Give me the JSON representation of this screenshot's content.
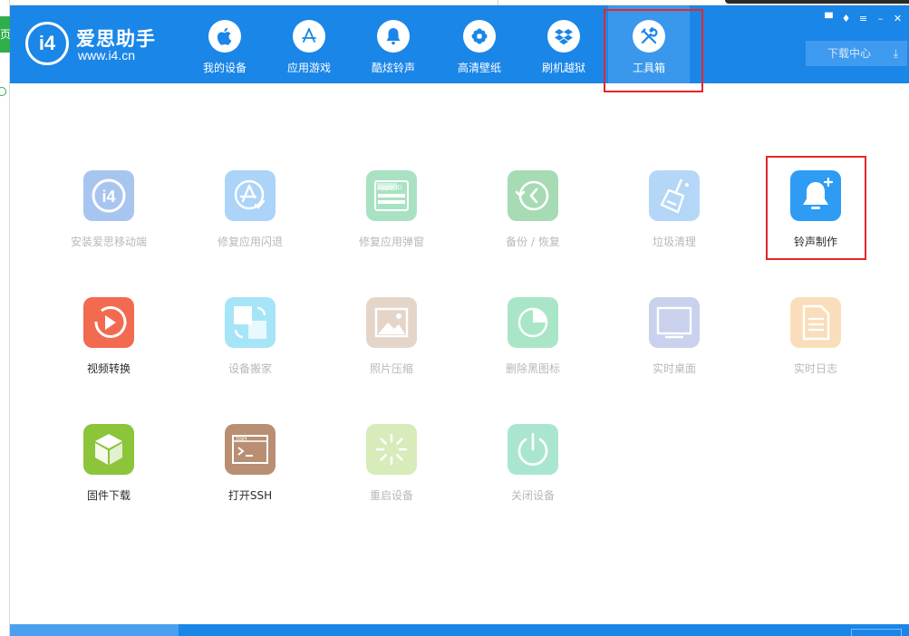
{
  "background": {
    "left_tab_char": "页"
  },
  "header": {
    "logo_mark": "i4",
    "brand_name": "爱思助手",
    "brand_url": "www.i4.cn",
    "nav": [
      {
        "label": "我的设备",
        "icon": "apple-icon"
      },
      {
        "label": "应用游戏",
        "icon": "app-store-icon"
      },
      {
        "label": "酷炫铃声",
        "icon": "bell-icon"
      },
      {
        "label": "高清壁纸",
        "icon": "flower-icon"
      },
      {
        "label": "刷机越狱",
        "icon": "dropbox-icon"
      },
      {
        "label": "工具箱",
        "icon": "tools-icon",
        "active": true
      }
    ],
    "window_controls": [
      "feedback-icon",
      "skin-icon",
      "menu-icon",
      "minimize-icon",
      "close-icon"
    ],
    "download_center": "下载中心"
  },
  "tools": [
    {
      "label": "安装爱思移动端",
      "icon": "i4-app-icon",
      "color": "#3f7fdc",
      "enabled": false
    },
    {
      "label": "修复应用闪退",
      "icon": "app-fix-icon",
      "color": "#4aa0f0",
      "enabled": false
    },
    {
      "label": "修复应用弹窗",
      "icon": "apple-id-icon",
      "color": "#3fc07a",
      "enabled": false
    },
    {
      "label": "备份 / 恢复",
      "icon": "backup-restore-icon",
      "color": "#3cb05a",
      "enabled": false
    },
    {
      "label": "垃圾清理",
      "icon": "broom-icon",
      "color": "#5aa8f0",
      "enabled": false
    },
    {
      "label": "铃声制作",
      "icon": "ringtone-bell-icon",
      "color": "#2e9cf4",
      "enabled": true
    },
    {
      "label": "视频转换",
      "icon": "video-convert-icon",
      "color": "#f26a4f",
      "enabled": true
    },
    {
      "label": "设备搬家",
      "icon": "device-migrate-icon",
      "color": "#3cc4f0",
      "enabled": false
    },
    {
      "label": "照片压缩",
      "icon": "photo-compress-icon",
      "color": "#c7a489",
      "enabled": false
    },
    {
      "label": "删除黑图标",
      "icon": "delete-icon-icon",
      "color": "#43c887",
      "enabled": false
    },
    {
      "label": "实时桌面",
      "icon": "desktop-icon",
      "color": "#8a9ad8",
      "enabled": false
    },
    {
      "label": "实时日志",
      "icon": "log-icon",
      "color": "#f5b86a",
      "enabled": false
    },
    {
      "label": "固件下载",
      "icon": "firmware-box-icon",
      "color": "#8cc43a",
      "enabled": true
    },
    {
      "label": "打开SSH",
      "icon": "ssh-terminal-icon",
      "color": "#b88f72",
      "enabled": true
    },
    {
      "label": "重启设备",
      "icon": "restart-icon",
      "color": "#a8d46a",
      "enabled": false
    },
    {
      "label": "关闭设备",
      "icon": "power-icon",
      "color": "#45c896",
      "enabled": false
    }
  ],
  "tool_glyph_text": {
    "apple_id": "Apple ID",
    "ssh": "SSH",
    "i4": "i4"
  }
}
